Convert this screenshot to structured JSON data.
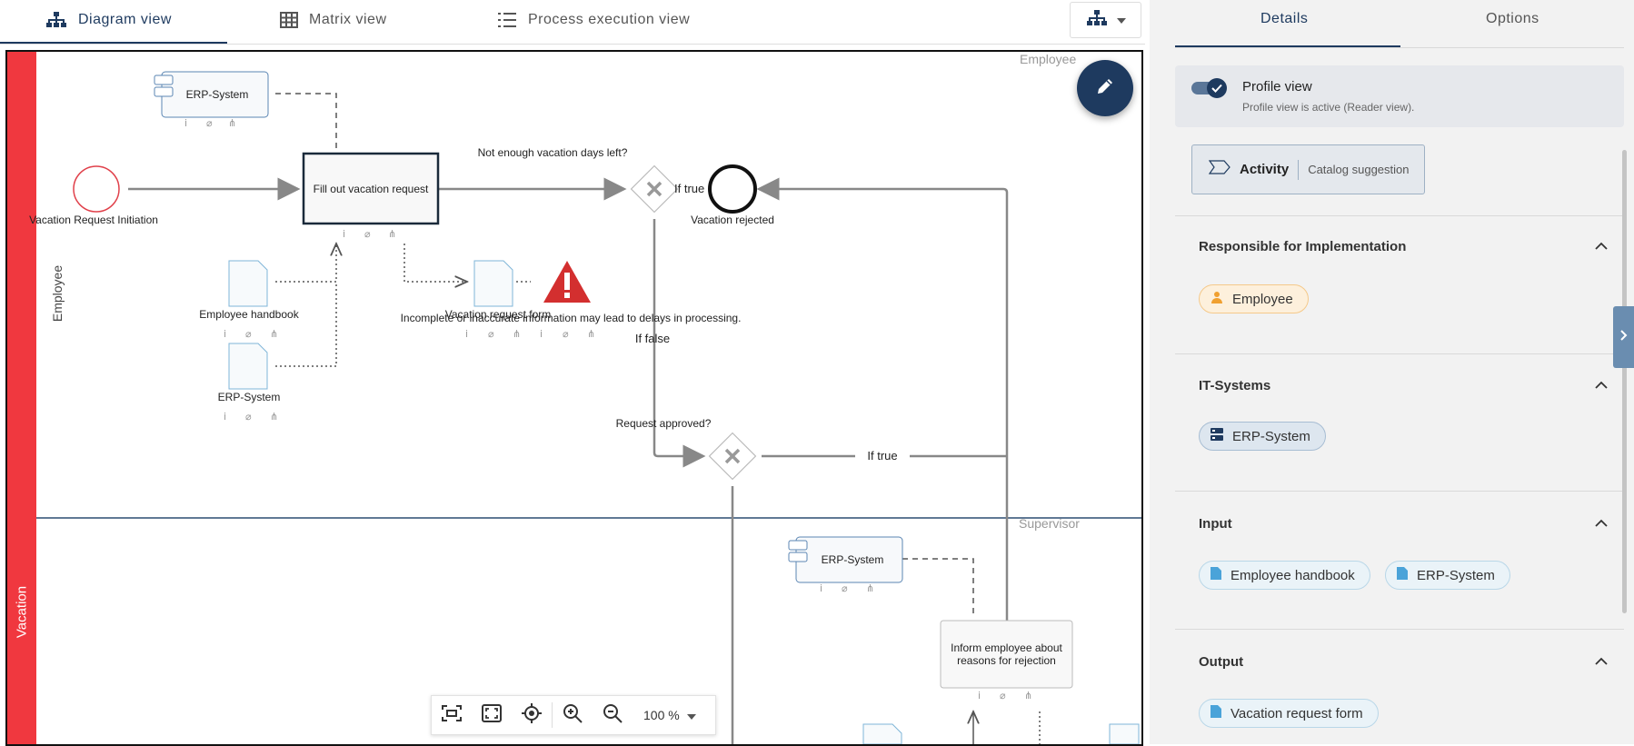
{
  "tabs": [
    {
      "label": "Diagram view",
      "icon": "diagram-icon",
      "active": true
    },
    {
      "label": "Matrix view",
      "icon": "grid-icon",
      "active": false
    },
    {
      "label": "Process execution view",
      "icon": "list-icon",
      "active": false
    }
  ],
  "view_dropdown_icon": "hierarchy-icon",
  "diagram": {
    "lanes": {
      "pool_label": "Vacation",
      "lane1_label": "Employee",
      "lane1_corner_label": "Employee",
      "lane2_corner_label": "Supervisor"
    },
    "nodes": {
      "start_event": "Vacation Request Initiation",
      "task1": "Fill out vacation request",
      "erp_top": "ERP-System",
      "doc_handbook": "Employee handbook",
      "doc_erp": "ERP-System",
      "doc_form": "Vacation request form",
      "gateway1_label": "Not enough vacation days left?",
      "gateway1_true": "If true",
      "gateway1_false": "If false",
      "end_event": "Vacation rejected",
      "warning_text": "Incomplete or inaccurate information may lead to delays in processing.",
      "gateway2_label": "Request approved?",
      "gateway2_true": "If true",
      "erp_lane2": "ERP-System",
      "task2_line1": "Inform employee about",
      "task2_line2": "reasons for rejection"
    },
    "zoom": "100 %"
  },
  "panel": {
    "tabs": [
      "Details",
      "Options"
    ],
    "profile_view": {
      "title": "Profile view",
      "subtitle": "Profile view is active (Reader view).",
      "enabled": true
    },
    "activity": {
      "label": "Activity",
      "suggestion": "Catalog suggestion"
    },
    "sections": [
      {
        "title": "Responsible for Implementation",
        "chips": [
          "Employee"
        ]
      },
      {
        "title": "IT-Systems",
        "chips": [
          "ERP-System"
        ]
      },
      {
        "title": "Input",
        "chips": [
          "Employee handbook",
          "ERP-System"
        ]
      },
      {
        "title": "Output",
        "chips": [
          "Vacation request form"
        ]
      }
    ]
  },
  "colors": {
    "accent": "#1e3a5f",
    "lane_red": "#f0383f",
    "warning_red": "#d32f2f"
  }
}
